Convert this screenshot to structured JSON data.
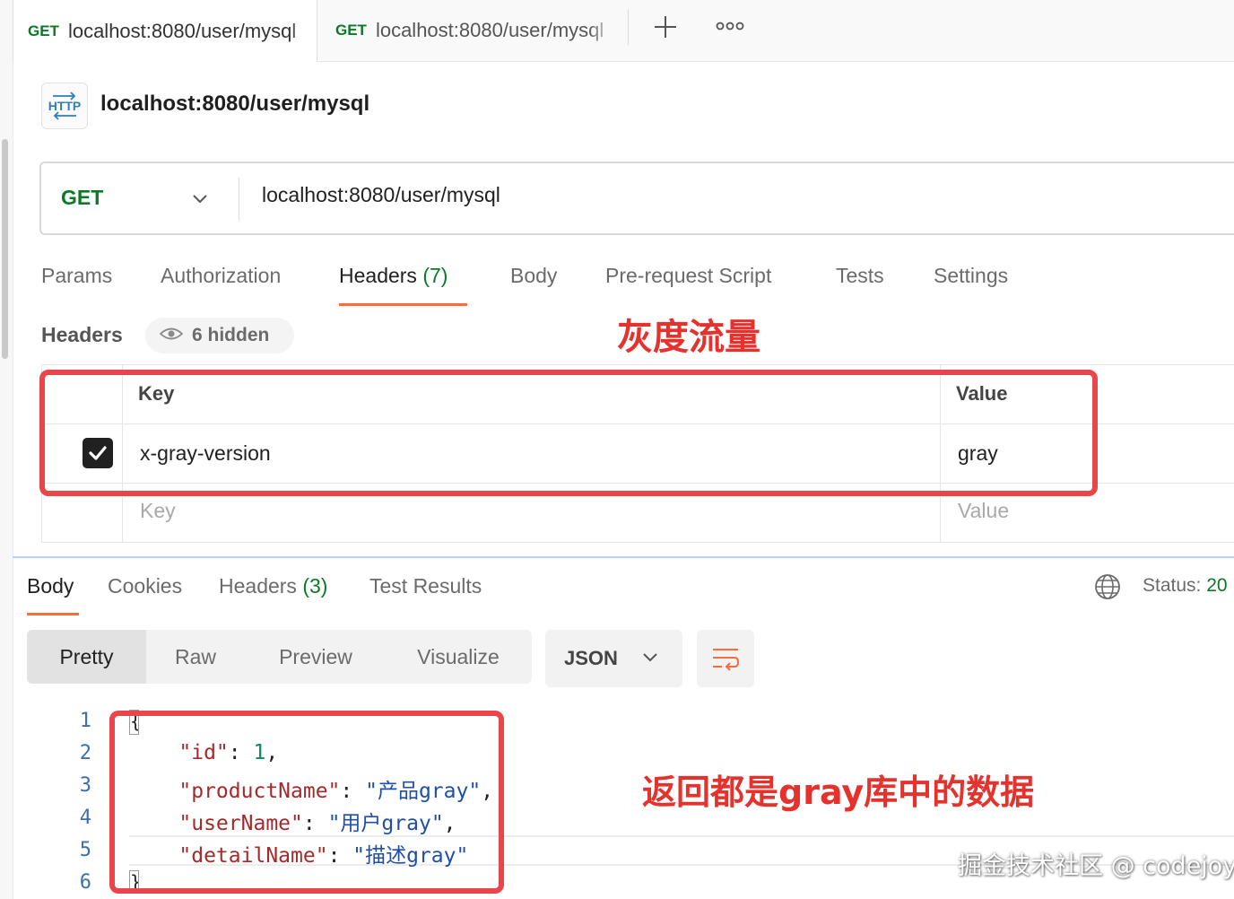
{
  "tabs": [
    {
      "method": "GET",
      "url": "localhost:8080/user/mysql"
    },
    {
      "method": "GET",
      "url": "localhost:8080/user/mysql"
    }
  ],
  "tab_actions": {
    "new_tab_icon": "plus-icon",
    "more_icon": "more-icon"
  },
  "request": {
    "icon": "http-icon",
    "icon_text": "HTTP",
    "title": "localhost:8080/user/mysql",
    "method": "GET",
    "url": "localhost:8080/user/mysql"
  },
  "request_tabs": [
    {
      "label": "Params"
    },
    {
      "label": "Authorization"
    },
    {
      "label": "Headers",
      "count": "(7)",
      "active": true
    },
    {
      "label": "Body"
    },
    {
      "label": "Pre-request Script"
    },
    {
      "label": "Tests"
    },
    {
      "label": "Settings"
    }
  ],
  "headers_section": {
    "label": "Headers",
    "hidden_text": "6 hidden",
    "columns": {
      "key": "Key",
      "value": "Value"
    },
    "rows": [
      {
        "checked": true,
        "key": "x-gray-version",
        "value": "gray"
      }
    ],
    "placeholders": {
      "key": "Key",
      "value": "Value"
    }
  },
  "annotations": {
    "header_note": "灰度流量",
    "response_note": "返回都是gray库中的数据"
  },
  "response_tabs": [
    {
      "label": "Body",
      "active": true
    },
    {
      "label": "Cookies"
    },
    {
      "label": "Headers",
      "count": "(3)"
    },
    {
      "label": "Test Results"
    }
  ],
  "status": {
    "label": "Status:",
    "value": "20"
  },
  "view_modes": [
    "Pretty",
    "Raw",
    "Preview",
    "Visualize"
  ],
  "active_view": "Pretty",
  "format": "JSON",
  "code": {
    "line_numbers": [
      "1",
      "2",
      "3",
      "4",
      "5",
      "6"
    ],
    "open_brace": "{",
    "close_brace": "}",
    "fields": [
      {
        "key": "\"id\"",
        "value": "1",
        "type": "number",
        "trail": ","
      },
      {
        "key": "\"productName\"",
        "value": "\"产品gray\"",
        "type": "string",
        "trail": ","
      },
      {
        "key": "\"userName\"",
        "value": "\"用户gray\"",
        "type": "string",
        "trail": ","
      },
      {
        "key": "\"detailName\"",
        "value": "\"描述gray\"",
        "type": "string",
        "trail": ""
      }
    ]
  },
  "watermark": "掘金技术社区 @ codejoy",
  "colors": {
    "accent": "#ff6c37",
    "method_green": "#0b7a26",
    "annotation_red": "#e9454a"
  }
}
